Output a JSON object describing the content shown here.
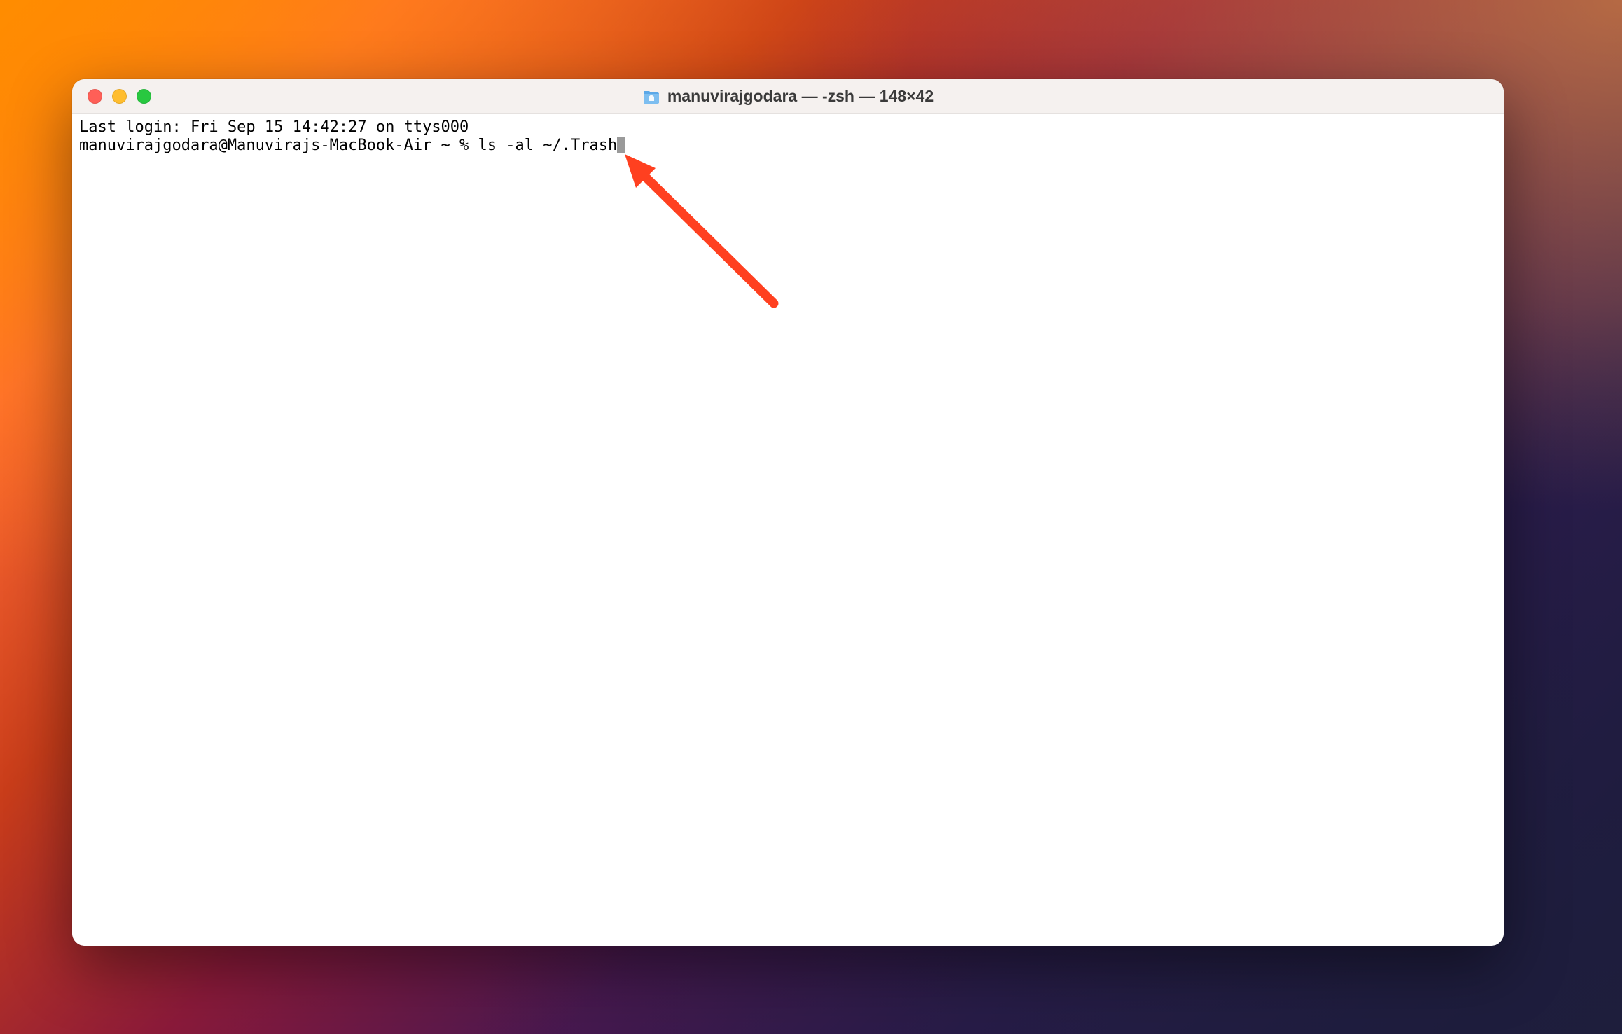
{
  "window": {
    "title": "manuvirajgodara — -zsh — 148×42"
  },
  "terminal": {
    "last_login_line": "Last login: Fri Sep 15 14:42:27 on ttys000",
    "prompt": "manuvirajgodara@Manuvirajs-MacBook-Air ~ % ",
    "command": "ls -al ~/.Trash"
  },
  "annotation": {
    "arrow_color": "#ff4020"
  }
}
